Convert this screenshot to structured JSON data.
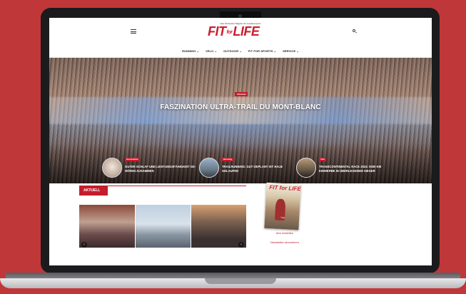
{
  "header": {
    "tagline": "Das Schweizer Magazin für Ausdauersport",
    "logo_text_1": "FIT",
    "logo_text_2": "for",
    "logo_text_3": "LIFE"
  },
  "nav": {
    "items": [
      {
        "label": "RUNNING ⌄"
      },
      {
        "label": "VELO ⌄"
      },
      {
        "label": "OUTDOOR ⌄"
      },
      {
        "label": "FIT FOR SPORTS ⌄"
      },
      {
        "label": "SERVICE ⌄"
      }
    ]
  },
  "hero": {
    "badge": "Ultratrail",
    "title": "FASZINATION ULTRA-TRAIL DU MONT-BLANC"
  },
  "teasers": [
    {
      "badge": "Gesundheit",
      "title": "GUTER SCHLAF UND LEISTUNGSFÄHIGKEIT GE-HÖREN ZUSAMMEN"
    },
    {
      "badge": "Running",
      "title": "TRAILRUNNING: GUT GEPLANT IST HALB GELAUFEN"
    },
    {
      "badge": "Velo",
      "title": "TRANSCONTINENTAL RACE 2024: 9300 KM EINWERBE IN ÜBERLEGENEM SIEGER"
    }
  ],
  "section": {
    "label": "AKTUELL"
  },
  "sidebar": {
    "magazine_logo": "FIT for LIFE",
    "magazine_caption": "Trail",
    "link_1": "Abo bestellen",
    "link_2": "Newsletter abonnieren"
  },
  "colors": {
    "background": "#c0373a",
    "brand_red": "#cc1f2e"
  }
}
